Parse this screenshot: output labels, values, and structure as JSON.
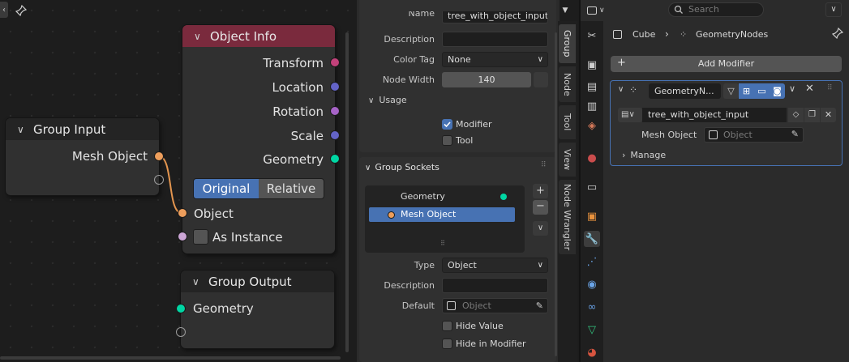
{
  "node_editor": {
    "nodes": {
      "object_info": {
        "title": "Object Info",
        "outputs": [
          "Transform",
          "Location",
          "Rotation",
          "Scale",
          "Geometry"
        ],
        "mode_options": [
          "Original",
          "Relative"
        ],
        "selected_mode": "Original",
        "input_object": "Object",
        "as_instance_label": "As Instance"
      },
      "group_input": {
        "title": "Group Input",
        "output": "Mesh Object"
      },
      "group_output": {
        "title": "Group Output",
        "input": "Geometry"
      }
    }
  },
  "sidebar": {
    "name_label": "Name",
    "name_value": "tree_with_object_input",
    "description_label": "Description",
    "color_tag_label": "Color Tag",
    "color_tag_value": "None",
    "node_width_label": "Node Width",
    "node_width_value": "140",
    "usage_label": "Usage",
    "usage_modifier": "Modifier",
    "usage_tool": "Tool",
    "sockets_panel_title": "Group Sockets",
    "sockets": [
      "Geometry",
      "Mesh Object"
    ],
    "type_label": "Type",
    "type_value": "Object",
    "desc2_label": "Description",
    "default_label": "Default",
    "default_placeholder": "Object",
    "hide_value": "Hide Value",
    "hide_in_modifier": "Hide in Modifier",
    "tabs": [
      "Group",
      "Node",
      "Tool",
      "View",
      "Node Wrangler"
    ]
  },
  "properties": {
    "search_placeholder": "Search",
    "breadcrumb_object": "Cube",
    "breadcrumb_modifier": "GeometryNodes",
    "add_modifier": "Add Modifier",
    "modifier_name": "GeometryN...",
    "node_group": "tree_with_object_input",
    "mesh_object_label": "Mesh Object",
    "object_placeholder": "Object",
    "manage_label": "Manage"
  },
  "colors": {
    "object_info_header": "#7a2a3d",
    "geometry_socket": "#00d6a3",
    "object_socket": "#ed9e5c",
    "vector_socket": "#6363c7",
    "rotation_socket": "#a663c7",
    "matrix_socket": "#c2417a",
    "accent_blue": "#4772b3"
  }
}
